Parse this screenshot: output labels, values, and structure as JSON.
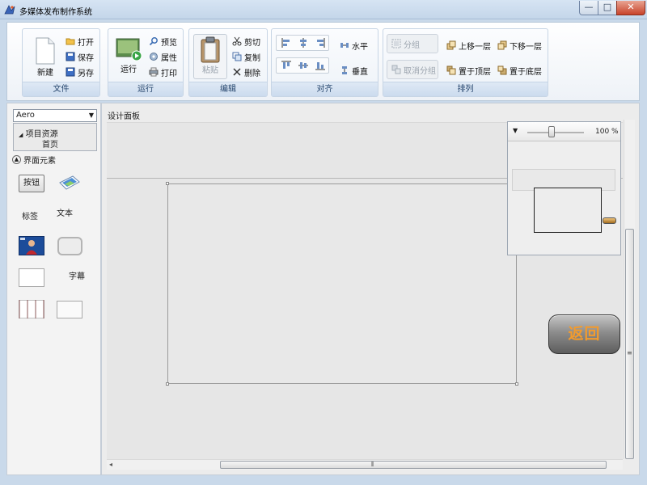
{
  "window": {
    "title": "多媒体发布制作系统",
    "minimize_glyph": "—",
    "maximize_glyph": "□",
    "close_glyph": "✕"
  },
  "ribbon": {
    "file": {
      "label": "文件",
      "new": "新建",
      "open": "打开",
      "save": "保存",
      "save_as": "另存"
    },
    "run": {
      "label": "运行",
      "run": "运行",
      "preview": "预览",
      "properties": "属性",
      "print": "打印"
    },
    "edit": {
      "label": "编辑",
      "paste": "粘贴",
      "cut": "剪切",
      "copy": "复制",
      "delete": "删除"
    },
    "align": {
      "label": "对齐",
      "horizontal": "水平",
      "vertical": "垂直"
    },
    "arrange": {
      "label": "排列",
      "group": "分组",
      "ungroup": "取消分组",
      "move_up": "上移一层",
      "move_down": "下移一层",
      "to_top": "置于顶层",
      "to_bottom": "置于底层"
    }
  },
  "left_panel": {
    "theme": "Aero",
    "tree_root": "项目资源",
    "tree_child": "首页",
    "section": "界面元素",
    "elements": {
      "button": "按钮",
      "label": "标签",
      "text": "文本",
      "subtitle": "字幕"
    }
  },
  "design_panel": {
    "title": "设计面板",
    "zoom": "100 %",
    "return_button": "返回"
  },
  "colors": {
    "accent": "#2f6aa8",
    "return_text": "#f29b2e"
  }
}
